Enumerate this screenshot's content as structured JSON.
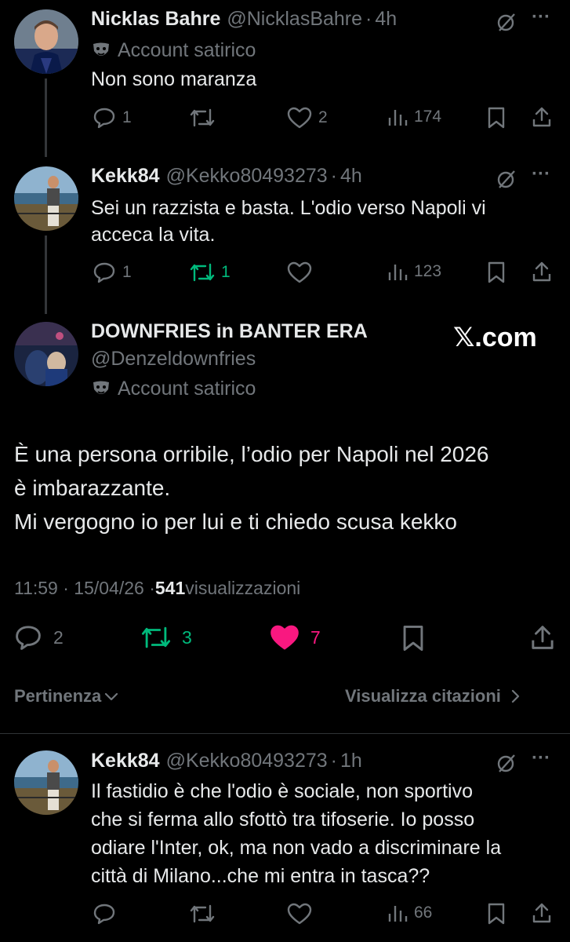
{
  "tweets": [
    {
      "name": "Nicklas Bahre",
      "handle": "@NicklasBahre",
      "time": "4h",
      "badge": "Account satirico",
      "text": "Non sono maranza",
      "replies": "1",
      "retweets": "",
      "likes": "2",
      "views": "174"
    },
    {
      "name": "Kekk84",
      "handle": "@Kekko80493273",
      "time": "4h",
      "text_lines": [
        "Sei un razzista e basta. L'odio verso Napoli vi",
        "acceca la vita."
      ],
      "replies": "1",
      "retweets": "1",
      "likes": "",
      "views": "123"
    }
  ],
  "main": {
    "name": "DOWNFRIES in BANTER ERA",
    "handle": "@Denzeldownfries",
    "badge": "Account satirico",
    "watermark": "𝕏.com",
    "text_lines": [
      "È una persona orribile, l’odio per Napoli nel 2026",
      "è imbarazzante.",
      "Mi vergogno io per lui e ti chiedo scusa kekko"
    ],
    "time": "11:59 · 15/04/26 · ",
    "views_count": "541",
    "views_label": " visualizzazioni",
    "replies": "2",
    "retweets": "3",
    "likes": "7",
    "colors": {
      "retweet": "#00ba7c",
      "like": "#f91880"
    }
  },
  "sort": {
    "left_label": "Pertinenza",
    "right_label": "Visualizza citazioni"
  },
  "reply": {
    "name": "Kekk84",
    "handle": "@Kekko80493273",
    "time": "1h",
    "text_lines": [
      "Il fastidio è che l'odio è sociale, non sportivo",
      "che si ferma allo sfottò tra tifoserie. Io posso",
      "odiare l'Inter, ok, ma non vado a discriminare la",
      "città di Milano...che mi entra in tasca??"
    ],
    "views": "66"
  },
  "separator": "·",
  "more": "···"
}
